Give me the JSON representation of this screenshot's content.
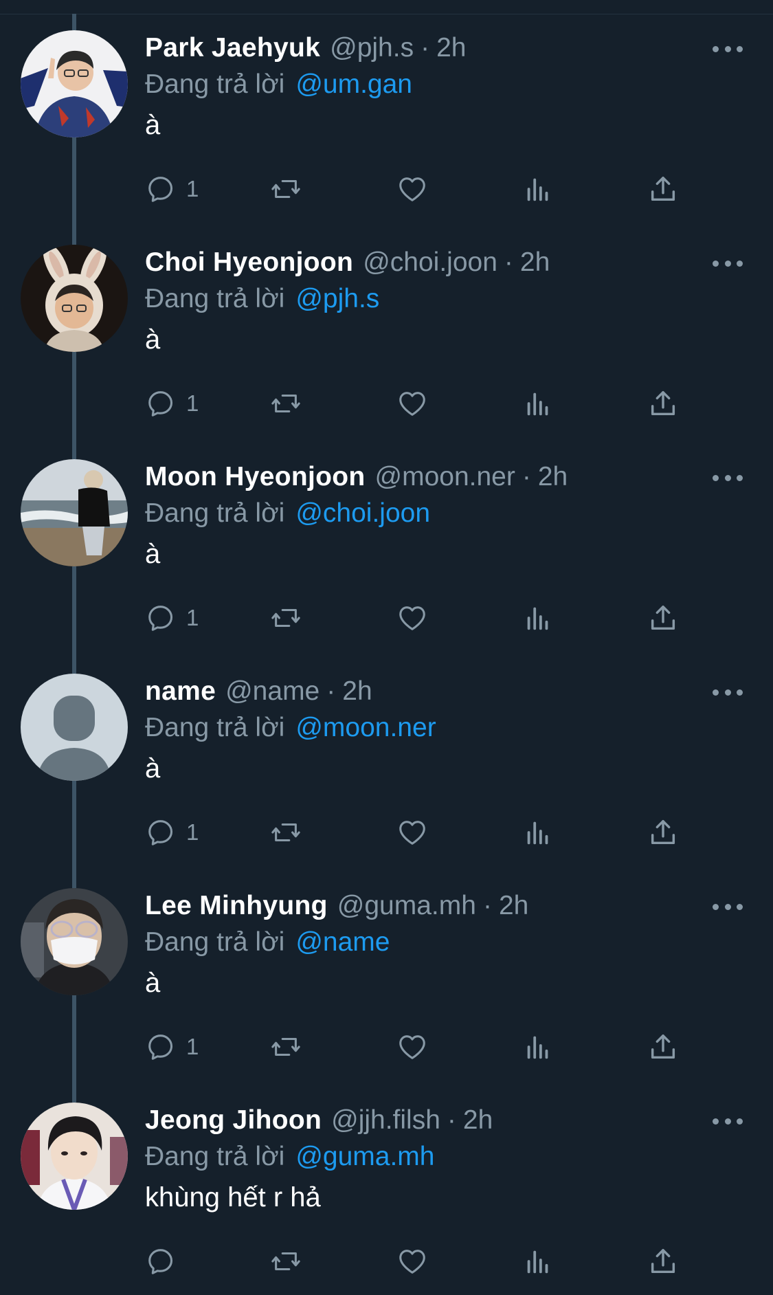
{
  "reply_prefix": "Đang trả lời",
  "tweets": [
    {
      "name": "Park Jaehyuk",
      "handle": "@pjh.s",
      "dot": "·",
      "time": "2h",
      "reply_to": "@um.gan",
      "text": "à",
      "reply_count": "1",
      "avatar_icon": "photo-avatar-icon"
    },
    {
      "name": "Choi Hyeonjoon",
      "handle": "@choi.joon",
      "dot": "·",
      "time": "2h",
      "reply_to": "@pjh.s",
      "text": "à",
      "reply_count": "1",
      "avatar_icon": "photo-avatar-icon"
    },
    {
      "name": "Moon Hyeonjoon",
      "handle": "@moon.ner",
      "dot": "·",
      "time": "2h",
      "reply_to": "@choi.joon",
      "text": "à",
      "reply_count": "1",
      "avatar_icon": "photo-avatar-icon"
    },
    {
      "name": "name",
      "handle": "@name",
      "dot": "·",
      "time": "2h",
      "reply_to": "@moon.ner",
      "text": "à",
      "reply_count": "1",
      "avatar_icon": "default-avatar-icon"
    },
    {
      "name": "Lee Minhyung",
      "handle": "@guma.mh",
      "dot": "·",
      "time": "2h",
      "reply_to": "@name",
      "text": "à",
      "reply_count": "1",
      "avatar_icon": "photo-avatar-icon"
    },
    {
      "name": "Jeong Jihoon",
      "handle": "@jjh.filsh",
      "dot": "·",
      "time": "2h",
      "reply_to": "@guma.mh",
      "text": "khùng hết r hả",
      "reply_count": "",
      "avatar_icon": "photo-avatar-icon"
    }
  ],
  "colors": {
    "background": "#15202b",
    "primary_text": "#ffffff",
    "secondary_text": "#8899a6",
    "link": "#1d9bf0",
    "thread_line": "#3d5466"
  }
}
